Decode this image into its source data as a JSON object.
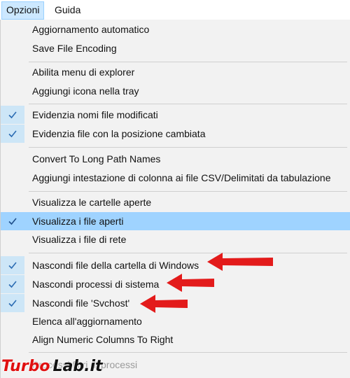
{
  "menubar": {
    "items": [
      {
        "label": "Opzioni"
      },
      {
        "label": "Guida"
      }
    ]
  },
  "menu": {
    "items": [
      {
        "label": "Aggiornamento automatico",
        "checked": false
      },
      {
        "label": "Save File Encoding",
        "checked": false
      },
      {
        "label": "Abilita menu di explorer",
        "checked": false
      },
      {
        "label": "Aggiungi icona nella tray",
        "checked": false
      },
      {
        "label": "Evidenzia nomi file modificati",
        "checked": true
      },
      {
        "label": "Evidenzia file con la posizione cambiata",
        "checked": true
      },
      {
        "label": "Convert To Long Path Names",
        "checked": false
      },
      {
        "label": "Aggiungi intestazione di colonna ai file CSV/Delimitati da tabulazione",
        "checked": false
      },
      {
        "label": "Visualizza le cartelle aperte",
        "checked": false
      },
      {
        "label": "Visualizza i file aperti",
        "checked": true,
        "highlighted": true
      },
      {
        "label": "Visualizza i file di rete",
        "checked": false
      },
      {
        "label": "Nascondi file della cartella di Windows",
        "checked": true
      },
      {
        "label": "Nascondi processi di sistema",
        "checked": true
      },
      {
        "label": "Nascondi file 'Svchost'",
        "checked": true
      },
      {
        "label": "Elenca all'aggiornamento",
        "checked": false
      },
      {
        "label": "Align Numeric Columns To Right",
        "checked": false
      },
      {
        "label": "Processi filtri di processi",
        "checked": false,
        "disabled": true
      }
    ]
  },
  "watermark": {
    "part1": "Turbo",
    "part2": "Lab.it"
  },
  "colors": {
    "highlight": "#9fd3ff",
    "check_gutter": "#cde6f7",
    "menu_background": "#f2f2f2",
    "arrow": "#e31b1b"
  },
  "icons": [
    "checkmark-icon",
    "red-arrow-icon",
    "turbolab-watermark-logo"
  ]
}
